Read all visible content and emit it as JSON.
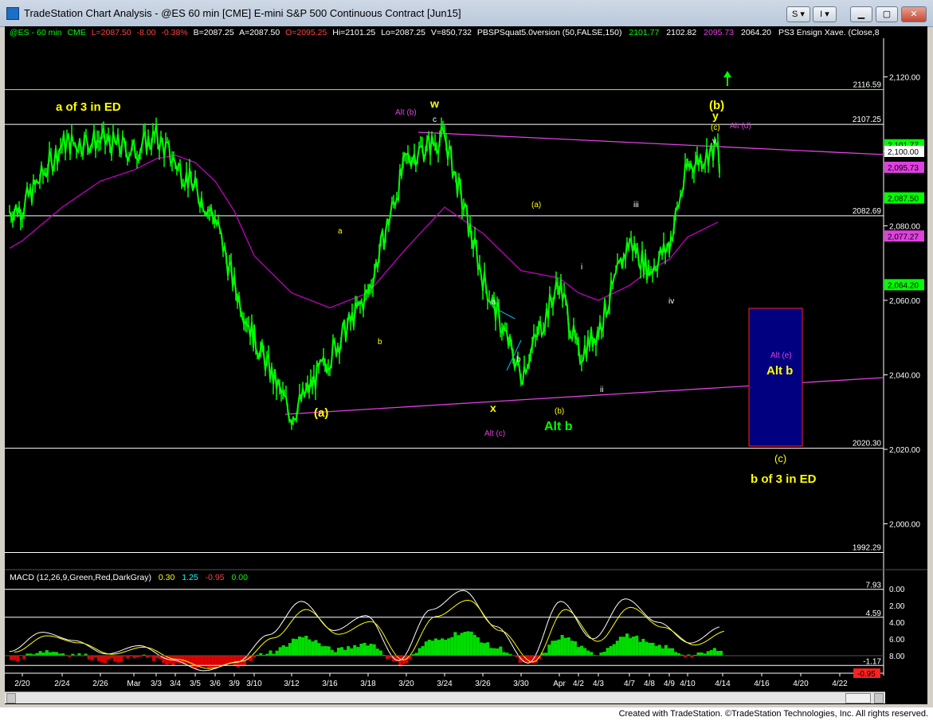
{
  "window": {
    "title": "TradeStation Chart Analysis - @ES 60 min [CME] E-mini S&P 500 Continuous Contract [Jun15]",
    "btn_s": "S",
    "btn_i": "I"
  },
  "status_text": "Created with TradeStation. ©TradeStation Technologies, Inc. All rights reserved.",
  "header": {
    "symbol": "@ES - 60 min",
    "exchange": "CME",
    "last": "L=2087.50",
    "change": "-8.00",
    "pct": "-0.38%",
    "bid": "B=2087.25",
    "ask": "A=2087.50",
    "open": "O=2095.25",
    "high": "Hi=2101.25",
    "low": "Lo=2087.25",
    "volume": "V=850,732",
    "indicator": "PBSPSquat5.0version (50,FALSE,150)",
    "v1": "2101.77",
    "v2": "2102.82",
    "v3": "2095.73",
    "v4": "2064.20",
    "indicator2": "PS3 Ensign Xave. (Close,8"
  },
  "macd_header": {
    "label": "MACD (12,26,9,Green,Red,DarkGray)",
    "v1": "0.30",
    "v2": "1.25",
    "v3": "-0.95",
    "v4": "0.00"
  },
  "colors": {
    "price": "#00ff00",
    "ma": "#c000c0",
    "trend": "#e040e0",
    "hline": "#ffffff",
    "green_line": "#80ff00",
    "annot_yellow": "#ffff00",
    "annot_green": "#00ff00",
    "annot_magenta": "#e040e0",
    "box": "#000080",
    "box_border": "#ff2020"
  },
  "chart_data": [
    {
      "type": "line",
      "title": "@ES 60 min",
      "series": [
        {
          "name": "@ES - 60 min",
          "x": [
            "2/20",
            "2/24",
            "2/26",
            "Mar",
            "3/3",
            "3/4",
            "3/5",
            "3/6",
            "3/9",
            "3/10",
            "3/12",
            "3/16",
            "3/18",
            "3/20",
            "3/24",
            "3/26",
            "3/30",
            "Apr",
            "4/2",
            "4/3",
            "4/7",
            "4/8",
            "4/9",
            "4/10"
          ],
          "values": [
            2085,
            2102,
            2103,
            2100,
            2104,
            2097,
            2090,
            2082,
            2064,
            2050,
            2029,
            2045,
            2062,
            2098,
            2104,
            2066,
            2040,
            2065,
            2045,
            2052,
            2076,
            2068,
            2075,
            2096
          ]
        },
        {
          "name": "PBSPSquat5.0version",
          "x": [
            "2/20",
            "2/24",
            "2/26",
            "Mar",
            "3/3",
            "3/4",
            "3/5",
            "3/6",
            "3/9",
            "3/10",
            "3/12",
            "3/16",
            "3/18",
            "3/20",
            "3/24",
            "3/26",
            "3/30",
            "Apr",
            "4/2",
            "4/3",
            "4/7",
            "4/8",
            "4/9",
            "4/10"
          ],
          "values": [
            2076,
            2085,
            2092,
            2095,
            2098,
            2099,
            2097,
            2092,
            2084,
            2072,
            2062,
            2058,
            2062,
            2074,
            2085,
            2078,
            2068,
            2066,
            2062,
            2060,
            2064,
            2068,
            2071,
            2077
          ]
        }
      ],
      "xlabels": [
        "2/20",
        "2/24",
        "2/26",
        "Mar",
        "3/3",
        "3/4",
        "3/5",
        "3/6",
        "3/9",
        "3/10",
        "3/12",
        "3/16",
        "3/18",
        "3/20",
        "3/24",
        "3/26",
        "3/30",
        "Apr",
        "4/2",
        "4/3",
        "4/7",
        "4/8",
        "4/9",
        "4/10",
        "4/14",
        "4/16",
        "4/20",
        "4/22"
      ],
      "yticks": [
        2000,
        2020,
        2040,
        2060,
        2080,
        2100,
        2120
      ],
      "ylim": [
        1990,
        2124
      ],
      "horizontal_levels": [
        {
          "value": 2116.59,
          "label": "2116.59"
        },
        {
          "value": 2107.25,
          "label": "2107.25"
        },
        {
          "value": 2082.69,
          "label": "2082.69"
        },
        {
          "value": 2020.3,
          "label": "2020.30"
        },
        {
          "value": 1992.29,
          "label": "1992.29"
        }
      ],
      "last_value_tags": [
        {
          "value": 2101.77,
          "label": "2,101.77"
        },
        {
          "value": 2100,
          "label": "2,100.00"
        },
        {
          "value": 2095.73,
          "label": "2,095.73"
        },
        {
          "value": 2087.5,
          "label": "2,087.50"
        },
        {
          "value": 2077.27,
          "label": "2,077.27"
        },
        {
          "value": 2064.2,
          "label": "2,064.20"
        }
      ],
      "annotations": [
        "a of 3 in ED",
        "Alt (b)",
        "w",
        "c",
        "(b)",
        "y",
        "(c)",
        "Alt (d)",
        "v",
        "a",
        "b",
        "(a)",
        "x",
        "Alt (c)",
        "(a)",
        "a",
        "b",
        "(b)",
        "Alt b",
        "i",
        "ii",
        "iii",
        "iv",
        "Alt (e)",
        "Alt b",
        "(c)",
        "b of 3 in ED"
      ],
      "grid": false
    },
    {
      "type": "bar",
      "title": "MACD (12,26,9,Green,Red,DarkGray)",
      "series": [
        {
          "name": "MACD",
          "values": [
            0.5,
            2.8,
            1.8,
            0.2,
            1.2,
            -0.5,
            -1.8,
            -0.8,
            2.5,
            6.5,
            3.0,
            4.8,
            -0.6,
            5.5,
            7.8,
            3.5,
            -0.9,
            6.5,
            2.0,
            6.8,
            4.0,
            1.5,
            3.5
          ]
        }
      ],
      "yticks": [
        0,
        2,
        4,
        6,
        8
      ],
      "tick_labels": [
        "8.00",
        "6.00",
        "4.00",
        "2.00",
        "0.00"
      ],
      "horizontal_levels": [
        {
          "value": 7.93,
          "label": "7.93"
        },
        {
          "value": 4.59,
          "label": "4.59"
        },
        {
          "value": -1.17,
          "label": "-1.17"
        }
      ],
      "last_value_tags": [
        {
          "value": -0.95,
          "label": "-0.95"
        }
      ],
      "ylim": [
        -2,
        9
      ]
    }
  ]
}
